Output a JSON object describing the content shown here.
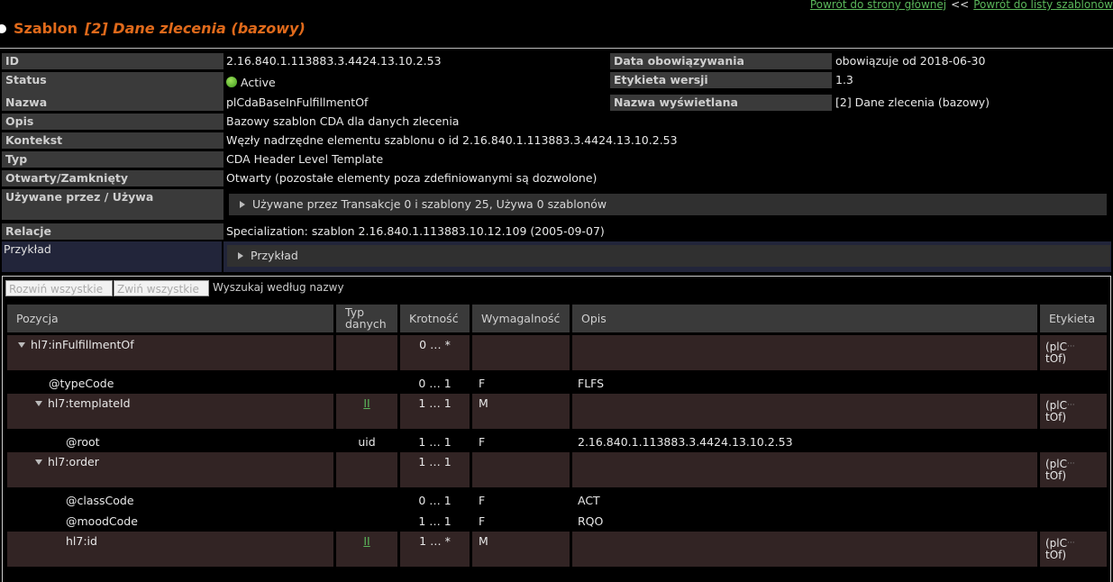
{
  "nav": {
    "home_link": "Powrót do strony głównej",
    "separator": "<<",
    "list_link": "Powrót do listy szablonów"
  },
  "header": {
    "prefix": "Szablon",
    "name": "[2] Dane zlecenia (bazowy)"
  },
  "meta": {
    "id_label": "ID",
    "id_value": "2.16.840.1.113883.3.4424.13.10.2.53",
    "valid_label": "Data obowiązywania",
    "valid_value": "obowiązuje od 2018-06-30",
    "status_label": "Status",
    "status_value": "Active",
    "version_label": "Etykieta wersji",
    "version_value": "1.3",
    "name_label": "Nazwa",
    "name_value": "plCdaBaseInFulfillmentOf",
    "display_label": "Nazwa wyświetlana",
    "display_value": "[2] Dane zlecenia (bazowy)",
    "desc_label": "Opis",
    "desc_value": "Bazowy szablon CDA dla danych zlecenia",
    "context_label": "Kontekst",
    "context_value": "Węzły nadrzędne elementu szablonu o id 2.16.840.1.113883.3.4424.13.10.2.53",
    "type_label": "Typ",
    "type_value": "CDA Header Level Template",
    "open_label": "Otwarty/Zamknięty",
    "open_value": "Otwarty (pozostałe elementy poza zdefiniowanymi są dozwolone)",
    "used_label": "Używane przez / Używa",
    "used_value": "Używane przez Transakcje 0 i szablony 25, Używa 0 szablonów",
    "rel_label": "Relacje",
    "rel_value": "Specialization: szablon 2.16.840.1.113883.10.12.109 (2005-09-07)",
    "example_label": "Przykład",
    "example_value": "Przykład"
  },
  "tree": {
    "expand_all": "Rozwiń wszystkie",
    "collapse_all": "Zwiń wszystkie",
    "search_placeholder": "Wyszukaj według nazwy",
    "columns": {
      "pos": "Pozycja",
      "type1": "Typ",
      "type2": "danych",
      "card": "Krotność",
      "conf": "Wymagalność",
      "desc": "Opis",
      "label": "Etykieta"
    },
    "rows": [
      {
        "name": "hl7:inFulfillmentOf",
        "type": "",
        "card": "0 … *",
        "conf": "",
        "desc": "",
        "lab1": "(plC",
        "lab2": "tOf)"
      },
      {
        "name": "@typeCode",
        "type": "",
        "card": "0 … 1",
        "conf": "F",
        "desc": "FLFS",
        "lab1": "",
        "lab2": ""
      },
      {
        "name": "hl7:templateId",
        "type": "II",
        "card": "1 … 1",
        "conf": "M",
        "desc": "",
        "lab1": "(plC",
        "lab2": "tOf)"
      },
      {
        "name": "@root",
        "type": "uid",
        "card": "1 … 1",
        "conf": "F",
        "desc": "2.16.840.1.113883.3.4424.13.10.2.53",
        "lab1": "",
        "lab2": ""
      },
      {
        "name": "hl7:order",
        "type": "",
        "card": "1 … 1",
        "conf": "",
        "desc": "",
        "lab1": "(plC",
        "lab2": "tOf)"
      },
      {
        "name": "@classCode",
        "type": "",
        "card": "0 … 1",
        "conf": "F",
        "desc": "ACT",
        "lab1": "",
        "lab2": ""
      },
      {
        "name": "@moodCode",
        "type": "",
        "card": "1 … 1",
        "conf": "F",
        "desc": "RQO",
        "lab1": "",
        "lab2": ""
      },
      {
        "name": "hl7:id",
        "type": "II",
        "card": "1 … *",
        "conf": "M",
        "desc": "",
        "lab1": "(plC",
        "lab2": "tOf)"
      }
    ]
  }
}
